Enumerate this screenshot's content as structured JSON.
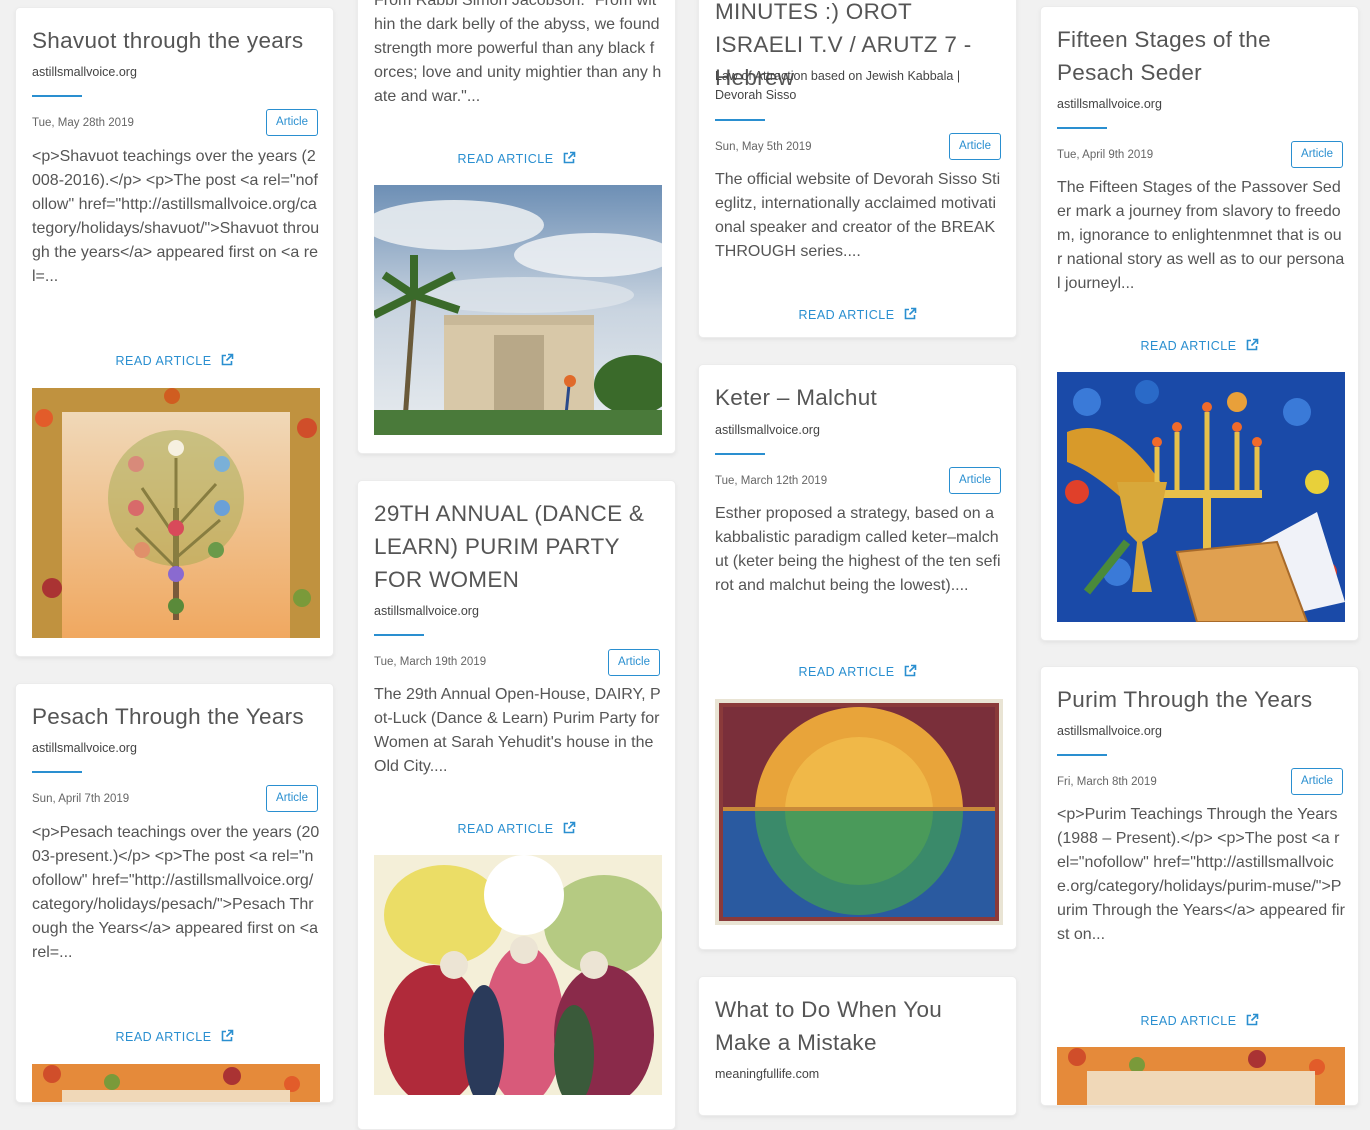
{
  "read_more_label": "READ ARTICLE",
  "badge_label": "Article",
  "colors": {
    "accent": "#2a8fd0",
    "page_bg": "#f1f1f1",
    "card_bg": "#ffffff"
  },
  "columns": [
    {
      "cards": [
        {
          "title": "Shavuot through the years",
          "source": "astillsmallvoice.org",
          "date": "Tue, May 28th 2019",
          "description": "<p>Shavuot teachings over the years (2008-2016).</p> <p>The post <a rel=\"nofollow\" href=\"http://astillsmallvoice.org/category/holidays/shavuot/\">Shavuot through the years</a> appeared first on <a rel=...",
          "image": "tree-of-life-painting"
        },
        {
          "title": "Pesach Through the Years",
          "source": "astillsmallvoice.org",
          "date": "Sun, April 7th 2019",
          "description": "<p>Pesach teachings over the years (2003-present.)</p> <p>The post <a rel=\"nofollow\" href=\"http://astillsmallvoice.org/category/holidays/pesach/\">Pesach Through the Years</a> appeared first on <a rel=...",
          "image": "colorful-painting"
        }
      ]
    },
    {
      "cards": [
        {
          "description": "From Rabbi Simon Jacobson: \"From within the dark belly of the abyss, we found strength more powerful than any black forces; love and unity mightier than any hate and war.\"...",
          "image": "building-with-palm-trees-photo"
        },
        {
          "title": "29TH ANNUAL (DANCE & LEARN) PURIM PARTY FOR WOMEN",
          "source": "astillsmallvoice.org",
          "date": "Tue, March 19th 2019",
          "description": "The 29th Annual Open-House, DAIRY, Pot-Luck (Dance & Learn) Purim Party for Women at Sarah Yehudit's house in the Old City....",
          "image": "dancing-women-painting"
        }
      ]
    },
    {
      "cards": [
        {
          "title": "MINUTES :) OROT ISRAELI T.V / ARUTZ 7 - Hebrew",
          "source": "Law of Attraction based on Jewish Kabbala | Devorah Sisso",
          "date": "Sun, May 5th 2019",
          "description": "The official website of Devorah Sisso Stieglitz, internationally acclaimed motivational speaker and creator of the BREAKTHROUGH series...."
        },
        {
          "title": "Keter – Malchut",
          "source": "astillsmallvoice.org",
          "date": "Tue, March 12th 2019",
          "description": "Esther proposed a strategy, based on a kabbalistic paradigm called keter–malchut (keter being the highest of the ten sefirot and malchut being the lowest)....",
          "image": "sun-over-sea-quilt"
        },
        {
          "title": "What to Do When You Make a Mistake",
          "source": "meaningfullife.com"
        }
      ]
    },
    {
      "cards": [
        {
          "title": "Fifteen Stages of the Pesach Seder",
          "source": "astillsmallvoice.org",
          "date": "Tue, April 9th 2019",
          "description": "The Fifteen Stages of the Passover Seder mark a journey from slavory to freedom, ignorance to enlightenmnet that is our national story as well as to our personal journeyl...",
          "image": "seder-stained-glass"
        },
        {
          "title": "Purim Through the Years",
          "source": "astillsmallvoice.org",
          "date": "Fri, March 8th 2019",
          "description": "<p>Purim Teachings Through the Years (1988 – Present).</p> <p>The post <a rel=\"nofollow\" href=\"http://astillsmallvoice.org/category/holidays/purim-muse/\">Purim Through the Years</a> appeared first on...",
          "image": "colorful-painting"
        }
      ]
    }
  ]
}
